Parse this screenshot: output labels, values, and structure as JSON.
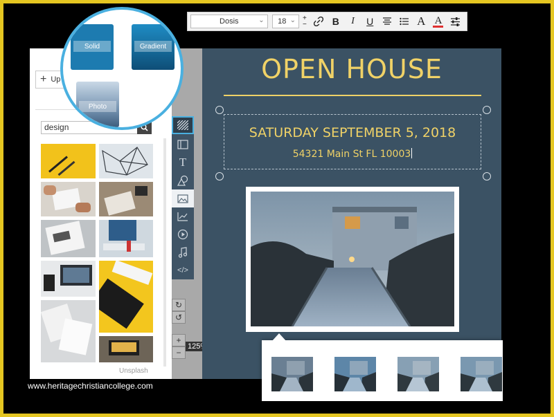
{
  "toolbar": {
    "font_family": "Dosis",
    "font_size": "18",
    "tools": [
      "link-icon",
      "bold-icon",
      "italic-icon",
      "underline-icon",
      "align-center-icon",
      "list-icon",
      "text-color-icon",
      "highlight-color-icon",
      "settings-sliders-icon"
    ],
    "bold": "B",
    "italic": "I",
    "underline": "U",
    "font_a": "A"
  },
  "left_panel": {
    "upload_label": "Up",
    "search_value": "design",
    "credit": "Unsplash"
  },
  "background_menu": {
    "solid": "Solid",
    "gradient": "Gradient",
    "photo": "Photo"
  },
  "tools": {
    "text_glyph": "T",
    "code_glyph": "</>"
  },
  "zoom": "125%",
  "canvas": {
    "title": "OPEN HOUSE",
    "date": "SATURDAY SEPTEMBER 5, 2018",
    "address": "54321 Main St FL 10003",
    "colors": {
      "background": "#3b5264",
      "accent": "#f0d267"
    }
  },
  "watermark": "www.heritagechristiancollege.com"
}
